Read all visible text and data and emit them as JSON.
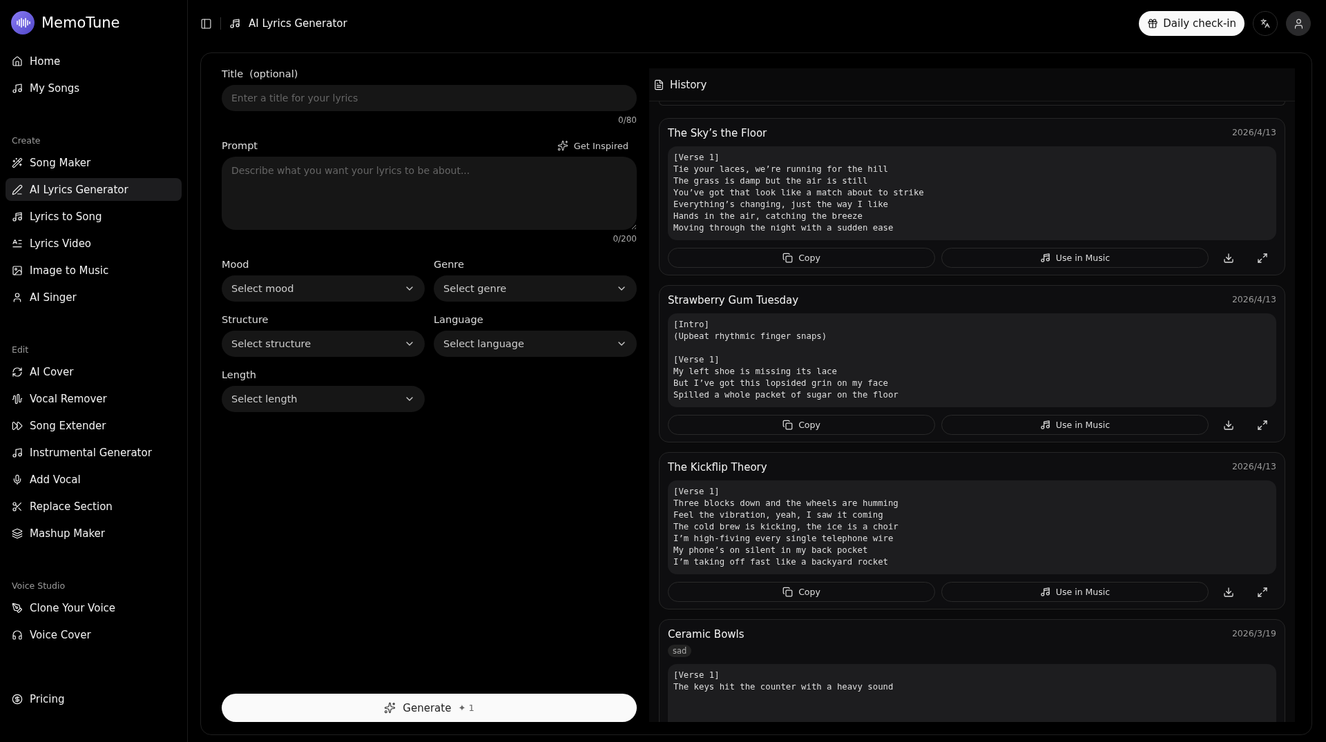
{
  "brand": {
    "name": "MemoTune"
  },
  "sidebar": {
    "sections": [
      {
        "items": [
          {
            "label": "Home",
            "selected": false
          },
          {
            "label": "My Songs",
            "selected": false
          }
        ]
      },
      {
        "heading": "Create",
        "items": [
          {
            "label": "Song Maker",
            "selected": false
          },
          {
            "label": "AI Lyrics Generator",
            "selected": true
          },
          {
            "label": "Lyrics to Song",
            "selected": false
          },
          {
            "label": "Lyrics Video",
            "selected": false
          },
          {
            "label": "Image to Music",
            "selected": false
          },
          {
            "label": "AI Singer",
            "selected": false
          }
        ]
      },
      {
        "heading": "Edit",
        "items": [
          {
            "label": "AI Cover",
            "selected": false
          },
          {
            "label": "Vocal Remover",
            "selected": false
          },
          {
            "label": "Song Extender",
            "selected": false
          },
          {
            "label": "Instrumental Generator",
            "selected": false
          },
          {
            "label": "Add Vocal",
            "selected": false
          },
          {
            "label": "Replace Section",
            "selected": false
          },
          {
            "label": "Mashup Maker",
            "selected": false
          }
        ]
      },
      {
        "heading": "Voice Studio",
        "items": [
          {
            "label": "Clone Your Voice",
            "selected": false
          },
          {
            "label": "Voice Cover",
            "selected": false
          }
        ]
      },
      {
        "items": [
          {
            "label": "Pricing",
            "selected": false
          }
        ]
      }
    ]
  },
  "topbar": {
    "page_title": "AI Lyrics Generator",
    "checkin_button": "Daily check-in"
  },
  "form": {
    "title_label": "Title",
    "title_optional": "(optional)",
    "title_placeholder": "Enter a title for your lyrics",
    "title_count": "0/80",
    "prompt_label": "Prompt",
    "inspire_button": "Get Inspired",
    "prompt_placeholder": "Describe what you want your lyrics to be about...",
    "prompt_count": "0/200",
    "selects": [
      {
        "label": "Mood",
        "placeholder": "Select mood"
      },
      {
        "label": "Genre",
        "placeholder": "Select genre"
      },
      {
        "label": "Structure",
        "placeholder": "Select structure"
      },
      {
        "label": "Language",
        "placeholder": "Select language"
      },
      {
        "label": "Length",
        "placeholder": "Select length"
      }
    ],
    "generate_button": "Generate",
    "generate_cost": "✦ 1"
  },
  "history": {
    "title": "History",
    "cards": [
      {
        "title": "The Sky’s the Floor",
        "date": "2026/4/13",
        "copy_label": "Copy",
        "use_label": "Use in Music",
        "lyrics": "[Verse 1]\nTie your laces, we’re running for the hill\nThe grass is damp but the air is still\nYou’ve got that look like a match about to strike\nEverything’s changing, just the way I like\nHands in the air, catching the breeze\nMoving through the night with a sudden ease"
      },
      {
        "title": "Strawberry Gum Tuesday",
        "date": "2026/4/13",
        "copy_label": "Copy",
        "use_label": "Use in Music",
        "lyrics": "[Intro]\n(Upbeat rhythmic finger snaps)\n\n[Verse 1]\nMy left shoe is missing its lace\nBut I’ve got this lopsided grin on my face\nSpilled a whole packet of sugar on the floor"
      },
      {
        "title": "The Kickflip Theory",
        "date": "2026/4/13",
        "copy_label": "Copy",
        "use_label": "Use in Music",
        "lyrics": "[Verse 1]\nThree blocks down and the wheels are humming\nFeel the vibration, yeah, I saw it coming\nThe cold brew is kicking, the ice is a choir\nI’m high-fiving every single telephone wire\nMy phone’s on silent in my back pocket\nI’m taking off fast like a backyard rocket"
      },
      {
        "title": "Ceramic Bowls",
        "date": "2026/3/19",
        "tag": "sad",
        "lyrics": "[Verse 1]\nThe keys hit the counter with a heavy sound"
      }
    ]
  }
}
